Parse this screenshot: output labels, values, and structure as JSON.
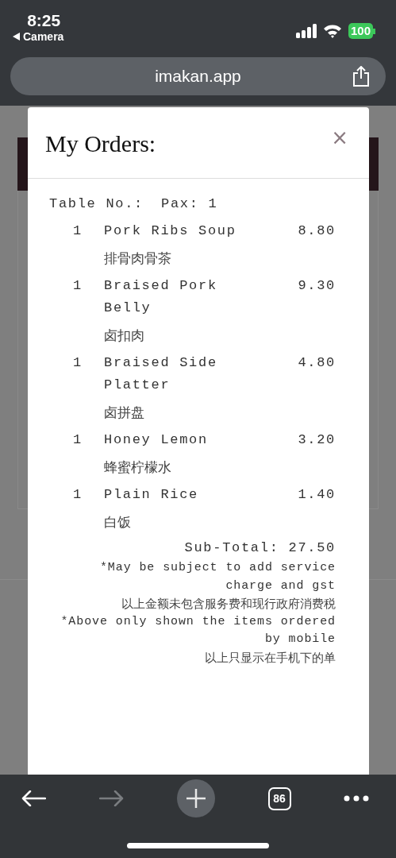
{
  "status_bar": {
    "time": "8:25",
    "back_app": "Camera",
    "battery": "100"
  },
  "address_bar": {
    "url": "imakan.app"
  },
  "modal": {
    "title": "My Orders:",
    "close": "×",
    "table_label": "Table No.:",
    "pax": "Pax: 1",
    "items": [
      {
        "qty": "1",
        "name": "Pork Ribs Soup",
        "name_zh": "排骨肉骨茶",
        "price": "8.80"
      },
      {
        "qty": "1",
        "name": "Braised Pork Belly",
        "name_zh": "卤扣肉",
        "price": "9.30"
      },
      {
        "qty": "1",
        "name": "Braised Side Platter",
        "name_zh": "卤拼盘",
        "price": "4.80"
      },
      {
        "qty": "1",
        "name": "Honey Lemon",
        "name_zh": "蜂蜜柠檬水",
        "price": "3.20"
      },
      {
        "qty": "1",
        "name": "Plain Rice",
        "name_zh": "白饭",
        "price": "1.40"
      }
    ],
    "subtotal": "Sub-Total: 27.50",
    "notes": [
      {
        "kind": "en",
        "text": "*May be subject to add service charge and gst"
      },
      {
        "kind": "zh",
        "text": "以上金额未包含服务费和现行政府消费税"
      },
      {
        "kind": "en",
        "text": "*Above only shown the items ordered by mobile"
      },
      {
        "kind": "zh",
        "text": "以上只显示在手机下的单"
      }
    ]
  },
  "toolbar": {
    "nav": [
      {
        "kind": "back",
        "disabled": false
      },
      {
        "kind": "forward",
        "disabled": true
      }
    ],
    "tab_count": "86"
  }
}
